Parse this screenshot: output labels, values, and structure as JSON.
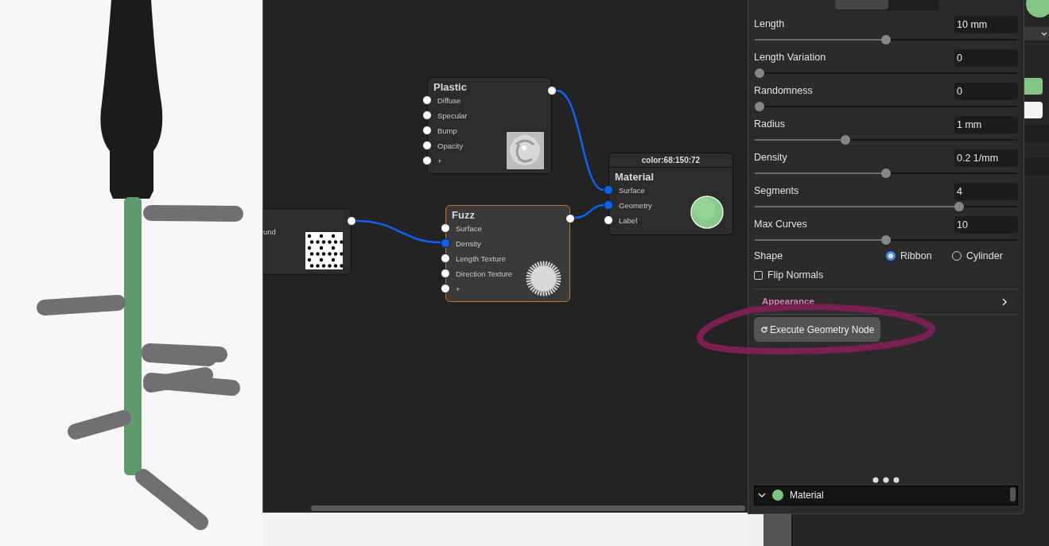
{
  "node_editor": {
    "nodes": [
      {
        "kind": "texture",
        "label": "und"
      },
      {
        "kind": "plastic",
        "title": "Plastic",
        "selected": false,
        "inputs": [
          {
            "label": "Diffuse",
            "connected": false
          },
          {
            "label": "Specular",
            "connected": false
          },
          {
            "label": "Bump",
            "connected": false
          },
          {
            "label": "Opacity",
            "connected": false
          },
          {
            "label": "+",
            "connected": false
          }
        ]
      },
      {
        "kind": "fuzz",
        "title": "Fuzz",
        "selected": true,
        "inputs": [
          {
            "label": "Surface",
            "connected": false
          },
          {
            "label": "Density",
            "connected": true
          },
          {
            "label": "Length Texture",
            "connected": false
          },
          {
            "label": "Direction Texture",
            "connected": false
          },
          {
            "label": "+",
            "connected": false
          }
        ]
      },
      {
        "kind": "material",
        "title": "Material",
        "header": "color:68:150:72",
        "selected": false,
        "inputs": [
          {
            "label": "Surface",
            "connected": true
          },
          {
            "label": "Geometry",
            "connected": true
          },
          {
            "label": "Label",
            "connected": false
          }
        ]
      }
    ]
  },
  "properties": {
    "sliders": [
      {
        "label": "Length",
        "value": "10 mm",
        "level": 0.5
      },
      {
        "label": "Length Variation",
        "value": "0",
        "level": 0
      },
      {
        "label": "Randomness",
        "value": "0",
        "level": 0
      },
      {
        "label": "Radius",
        "value": "1 mm",
        "level": 0.34
      },
      {
        "label": "Density",
        "value": "0.2 1/mm",
        "level": 0.5
      },
      {
        "label": "Segments",
        "value": "4",
        "level": 0.79
      },
      {
        "label": "Max Curves",
        "value": "10",
        "level": 0.5
      }
    ],
    "shape": {
      "label": "Shape",
      "options": [
        {
          "label": "Ribbon",
          "selected": true
        },
        {
          "label": "Cylinder",
          "selected": false
        }
      ]
    },
    "flip_normals": {
      "label": "Flip Normals",
      "checked": false
    },
    "appearance": {
      "label": "Appearance",
      "expanded": false
    },
    "execute_button": "Execute Geometry Node",
    "tree": [
      {
        "label": "Material",
        "expanded": true,
        "color": "#7cc47f"
      }
    ]
  }
}
